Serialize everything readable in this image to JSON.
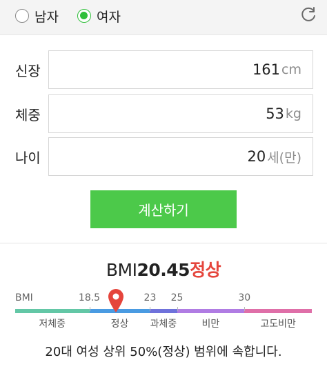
{
  "gender": {
    "options": [
      {
        "label": "남자",
        "selected": false
      },
      {
        "label": "여자",
        "selected": true
      }
    ]
  },
  "form": {
    "height": {
      "label": "신장",
      "value": "161",
      "unit": "cm"
    },
    "weight": {
      "label": "체중",
      "value": "53",
      "unit": "kg"
    },
    "age": {
      "label": "나이",
      "value": "20",
      "unit": "세(만)"
    }
  },
  "buttons": {
    "calculate": "계산하기",
    "refresh_icon": "refresh-icon"
  },
  "result": {
    "bmi_label": "BMI",
    "bmi_value": 20.45,
    "bmi_display": "20.45",
    "status": "정상",
    "status_color": "#e5453c",
    "summary": "20대 여성 상위 50%(정상) 범위에 속합니다."
  },
  "scale": {
    "min": 13,
    "max": 35,
    "start_label": "BMI",
    "ticks": [
      {
        "value": 18.5,
        "label": "18.5"
      },
      {
        "value": 23,
        "label": "23"
      },
      {
        "value": 25,
        "label": "25"
      },
      {
        "value": 30,
        "label": "30"
      }
    ],
    "categories": [
      {
        "label": "저체중",
        "from": 13,
        "to": 18.5,
        "color": "#63c7a6"
      },
      {
        "label": "정상",
        "from": 18.5,
        "to": 23,
        "color": "#4a9be2"
      },
      {
        "label": "과체중",
        "from": 23,
        "to": 25,
        "color": "#6f72db"
      },
      {
        "label": "비만",
        "from": 25,
        "to": 30,
        "color": "#b07ce3"
      },
      {
        "label": "고도비만",
        "from": 30,
        "to": 35,
        "color": "#df6fa8"
      }
    ],
    "marker_color": "#e5453c"
  }
}
